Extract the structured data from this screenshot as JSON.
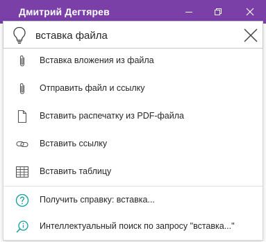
{
  "titlebar": {
    "user_name": "Дмитрий Дегтярев"
  },
  "search": {
    "value": "вставка файла",
    "icon": "lightbulb-icon",
    "clear_icon": "close-icon"
  },
  "results": [
    {
      "label": "Вставка вложения из файла",
      "icon": "paperclip-icon"
    },
    {
      "label": "Отправить файл и ссылку",
      "icon": "paperclip-icon"
    },
    {
      "label": "Вставить распечатку из PDF-файла",
      "icon": "document-icon"
    },
    {
      "label": "Вставить ссылку",
      "icon": "link-icon"
    },
    {
      "label": "Вставить таблицу",
      "icon": "table-icon"
    }
  ],
  "help": [
    {
      "label": "Получить справку: вставка...",
      "icon": "help-icon"
    },
    {
      "label": "Интеллектуальный поиск по запросу \"вставка...\"",
      "icon": "smart-lookup-icon"
    }
  ],
  "colors": {
    "titlebar": "#7b3fa8",
    "accent_teal": "#0f9d9d"
  }
}
